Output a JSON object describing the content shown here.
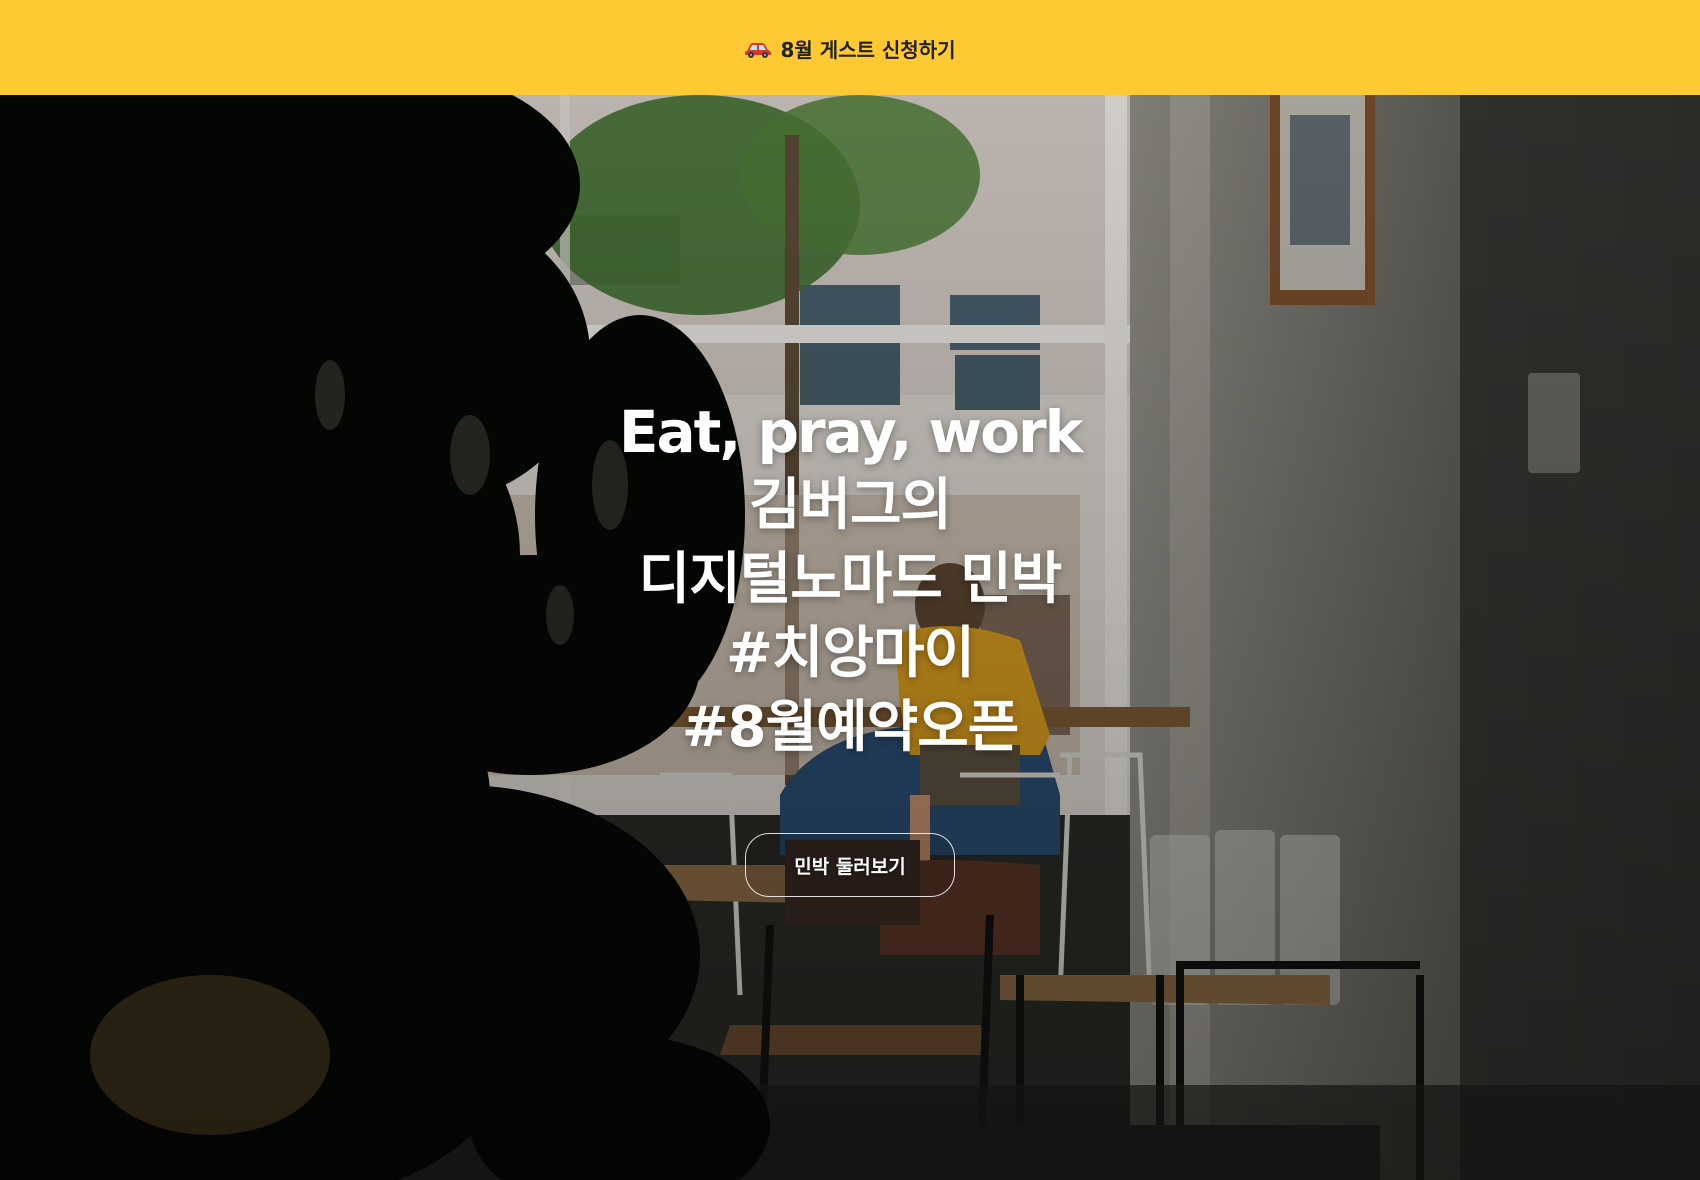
{
  "announcement": {
    "icon": "car-icon",
    "text": "8월 게스트 신청하기",
    "background_color": "#ffc933"
  },
  "hero": {
    "title_lines": [
      "Eat, pray, work",
      "김버그의",
      "디지털노마드 민박",
      "#치앙마이",
      "#8월예약오픈"
    ],
    "cta_label": "민박 둘러보기",
    "background": "photo of a cafe interior with large plants and a window"
  }
}
